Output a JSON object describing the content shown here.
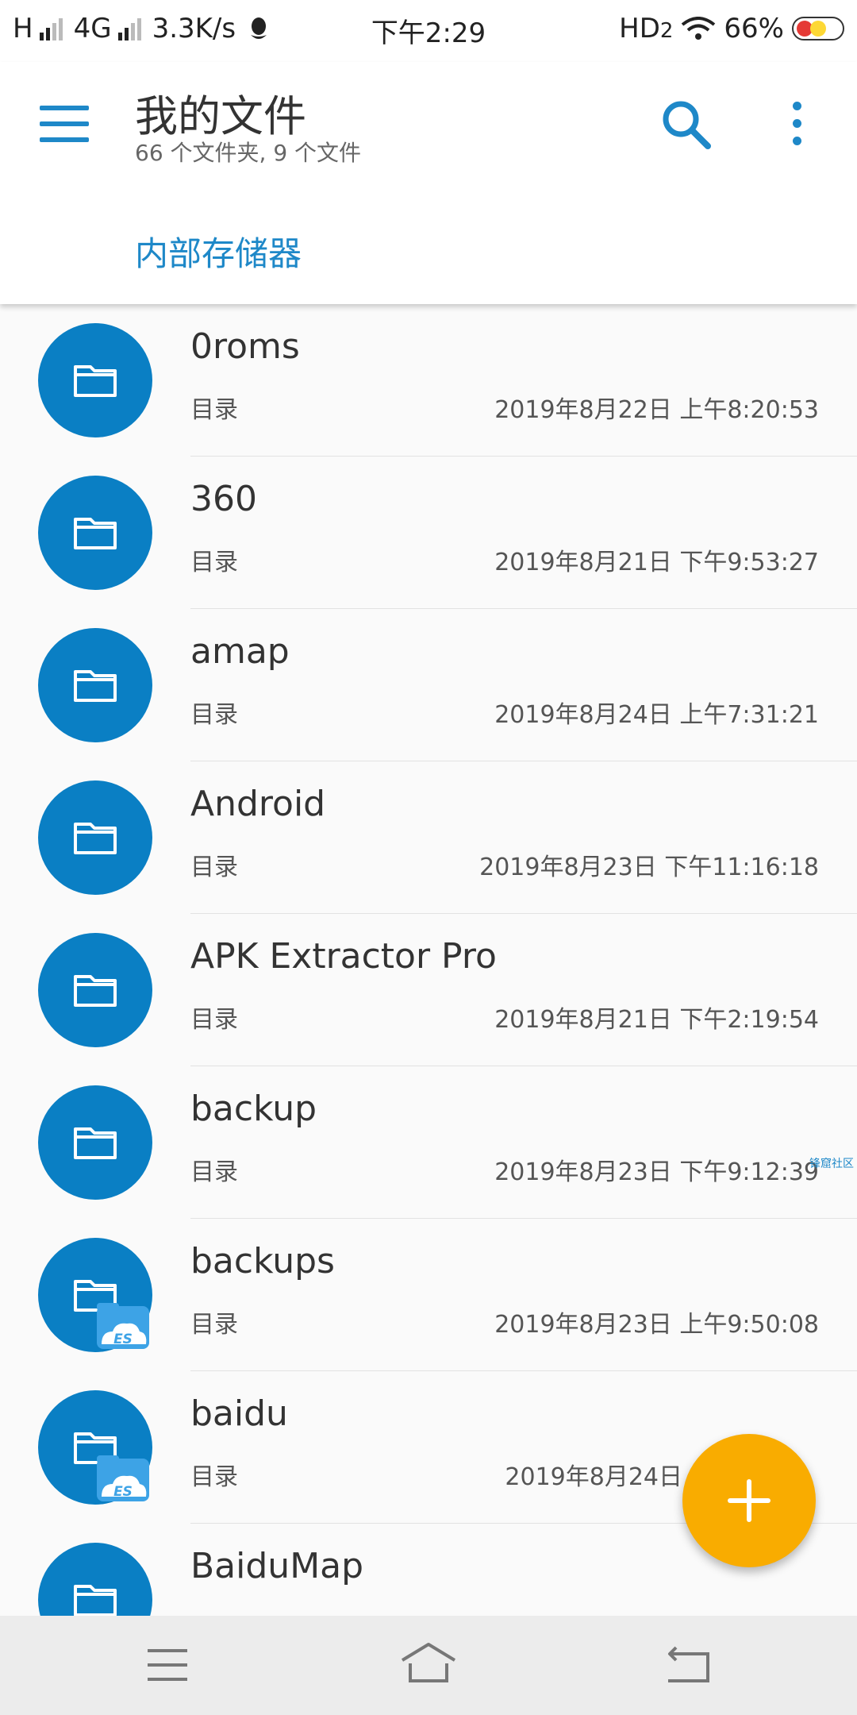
{
  "status_bar": {
    "carrier_left": "H",
    "network": "4G",
    "speed": "3.3K/s",
    "time": "下午2:29",
    "hd": "HD",
    "hd_sub": "2",
    "battery": "66%"
  },
  "app_bar": {
    "title": "我的文件",
    "subtitle": "66 个文件夹, 9 个文件",
    "breadcrumb": "内部存储器"
  },
  "files": [
    {
      "name": "0roms",
      "type": "目录",
      "date": "2019年8月22日 上午8:20:53",
      "badge": false
    },
    {
      "name": "360",
      "type": "目录",
      "date": "2019年8月21日 下午9:53:27",
      "badge": false
    },
    {
      "name": "amap",
      "type": "目录",
      "date": "2019年8月24日 上午7:31:21",
      "badge": false
    },
    {
      "name": "Android",
      "type": "目录",
      "date": "2019年8月23日 下午11:16:18",
      "badge": false
    },
    {
      "name": "APK Extractor Pro",
      "type": "目录",
      "date": "2019年8月21日 下午2:19:54",
      "badge": false
    },
    {
      "name": "backup",
      "type": "目录",
      "date": "2019年8月23日 下午9:12:39",
      "badge": false
    },
    {
      "name": "backups",
      "type": "目录",
      "date": "2019年8月23日 上午9:50:08",
      "badge": true
    },
    {
      "name": "baidu",
      "type": "目录",
      "date": "2019年8月24日",
      "badge": true
    },
    {
      "name": "BaiduMap",
      "type": "",
      "date": "",
      "badge": false
    }
  ],
  "badge_text": "ES",
  "watermark": "锋窟社区",
  "colors": {
    "accent": "#1e88c8",
    "folder": "#0a7fc4",
    "fab": "#f9ac00"
  },
  "icons": {
    "menu": "hamburger-icon",
    "search": "search-icon",
    "more": "more-vertical-icon",
    "fab": "plus-icon",
    "nav_menu": "menu-lines-icon",
    "nav_home": "home-icon",
    "nav_back": "back-icon"
  }
}
